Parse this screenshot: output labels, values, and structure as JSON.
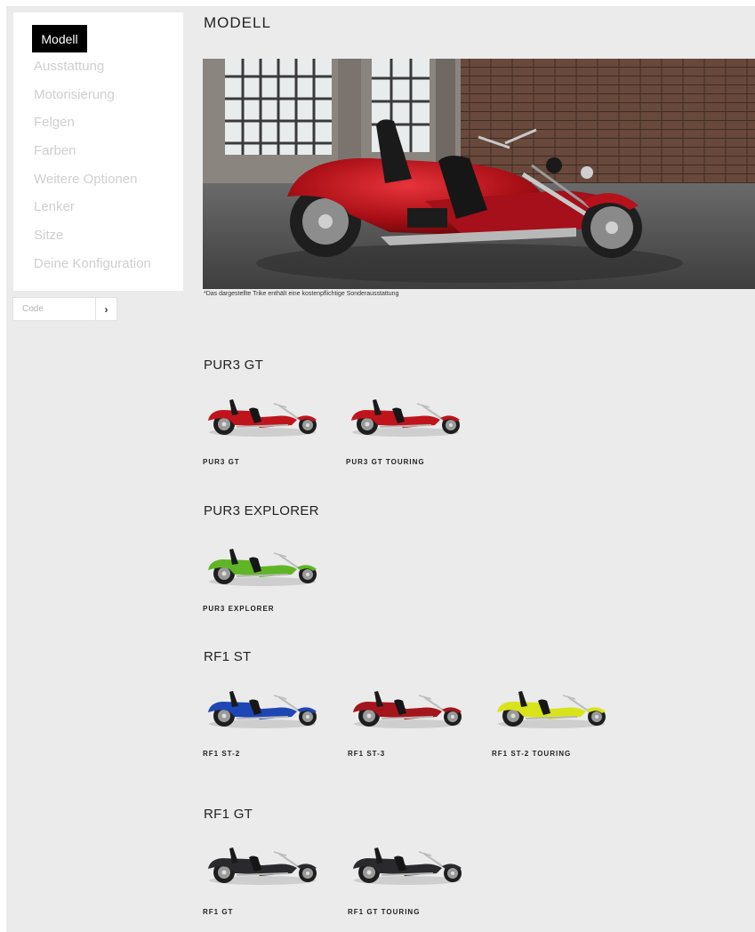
{
  "sidebar": {
    "items": [
      {
        "label": "Modell",
        "active": true
      },
      {
        "label": "Ausstattung"
      },
      {
        "label": "Motorisierung"
      },
      {
        "label": "Felgen"
      },
      {
        "label": "Farben"
      },
      {
        "label": "Weitere Optionen"
      },
      {
        "label": "Lenker"
      },
      {
        "label": "Sitze"
      },
      {
        "label": "Deine Konfiguration"
      }
    ],
    "code": {
      "placeholder": "Code",
      "button_icon": "chevron-right-icon",
      "button_glyph": "›"
    }
  },
  "main": {
    "title": "MODELL",
    "hero_disclaimer": "*Das dargestellte Trike enthält eine kostenpflichtige Sonderausstattung",
    "groups": [
      {
        "title": "PUR3 GT",
        "models": [
          {
            "label": "PUR3 GT",
            "color": "#c0141c"
          },
          {
            "label": "PUR3 GT TOURING",
            "color": "#c0141c"
          }
        ]
      },
      {
        "title": "PUR3 EXPLORER",
        "models": [
          {
            "label": "PUR3 EXPLORER",
            "color": "#5fb526"
          }
        ]
      },
      {
        "title": "RF1 ST",
        "models": [
          {
            "label": "RF1 ST-2",
            "color": "#1e46b4"
          },
          {
            "label": "RF1 ST-3",
            "color": "#a3161c"
          },
          {
            "label": "RF1 ST-2 TOURING",
            "color": "#d8e31a"
          }
        ]
      },
      {
        "title": "RF1 GT",
        "models": [
          {
            "label": "RF1 GT",
            "color": "#2a2a2e"
          },
          {
            "label": "RF1 GT TOURING",
            "color": "#2a2a2e"
          }
        ]
      }
    ]
  }
}
